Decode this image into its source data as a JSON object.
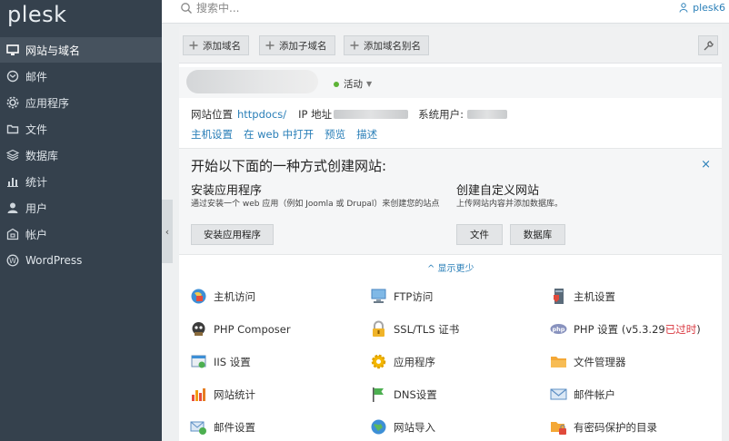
{
  "sidebar": {
    "logo": "plesk",
    "items": [
      {
        "label": "网站与域名",
        "icon": "monitor-icon",
        "active": true
      },
      {
        "label": "邮件",
        "icon": "mail-icon"
      },
      {
        "label": "应用程序",
        "icon": "gear-icon"
      },
      {
        "label": "文件",
        "icon": "folder-icon"
      },
      {
        "label": "数据库",
        "icon": "database-icon"
      },
      {
        "label": "统计",
        "icon": "bar-chart-icon"
      },
      {
        "label": "用户",
        "icon": "user-icon"
      },
      {
        "label": "帐户",
        "icon": "account-icon"
      },
      {
        "label": "WordPress",
        "icon": "wordpress-icon"
      }
    ]
  },
  "topbar": {
    "search_placeholder": "搜索中...",
    "username": "plesk6"
  },
  "toolbar": {
    "add_domain": "添加域名",
    "add_subdomain": "添加子域名",
    "add_alias": "添加域名别名"
  },
  "domain": {
    "status": "活动"
  },
  "info": {
    "location_label": "网站位置",
    "location_link": "httpdocs/",
    "ip_label": "IP 地址",
    "sysuser_label": "系统用户:"
  },
  "links": [
    "主机设置",
    "在 web 中打开",
    "预览",
    "描述"
  ],
  "create": {
    "title": "开始以下面的一种方式创建网站:",
    "close": "×",
    "install": {
      "title": "安装应用程序",
      "desc": "通过安装一个 web 应用（例如 Joomla 或 Drupal）来创建您的站点",
      "button": "安装应用程序"
    },
    "custom": {
      "title": "创建自定义网站",
      "desc": "上传网站内容并添加数据库。",
      "btn_files": "文件",
      "btn_db": "数据库"
    }
  },
  "show_less": "^ 显示更少",
  "features": [
    {
      "label": "主机访问"
    },
    {
      "label": "FTP访问"
    },
    {
      "label": "主机设置"
    },
    {
      "label": "PHP Composer"
    },
    {
      "label": "SSL/TLS 证书"
    },
    {
      "label": "PHP 设置 (v5.3.29 ",
      "warn": "已过时",
      "tail": ")"
    },
    {
      "label": "IIS 设置"
    },
    {
      "label": "应用程序"
    },
    {
      "label": "文件管理器"
    },
    {
      "label": "网站统计"
    },
    {
      "label": "DNS设置"
    },
    {
      "label": "邮件帐户"
    },
    {
      "label": "邮件设置"
    },
    {
      "label": "网站导入"
    },
    {
      "label": "有密码保护的目录"
    }
  ],
  "colors": {
    "sidebar_bg": "#35414d",
    "sidebar_active": "#46525e",
    "link": "#2a7fb8",
    "status_active": "#5db336",
    "outdated": "#d9363e"
  }
}
